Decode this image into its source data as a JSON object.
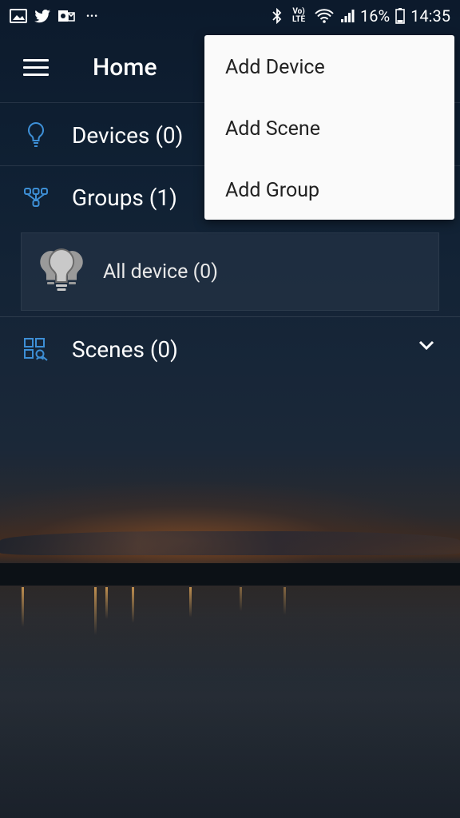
{
  "status_bar": {
    "lte_label": "LTE",
    "volte_label": "Vo)",
    "battery": "16%",
    "time": "14:35",
    "dots": "•••"
  },
  "app_bar": {
    "title": "Home"
  },
  "sections": {
    "devices": {
      "label": "Devices (0)",
      "icon": "lightbulb-icon"
    },
    "groups": {
      "label": "Groups (1)",
      "icon": "group-nodes-icon"
    },
    "scenes": {
      "label": "Scenes (0)",
      "icon": "scenes-grid-icon"
    }
  },
  "group_items": [
    {
      "label": "All device (0)",
      "icon": "bulbs-group-icon"
    }
  ],
  "popup_menu": {
    "items": [
      {
        "label": "Add Device"
      },
      {
        "label": "Add Scene"
      },
      {
        "label": "Add Group"
      }
    ]
  },
  "colors": {
    "accent_icon": "#3d8fd6",
    "menu_bg": "#fafafa",
    "menu_text": "#212121"
  }
}
